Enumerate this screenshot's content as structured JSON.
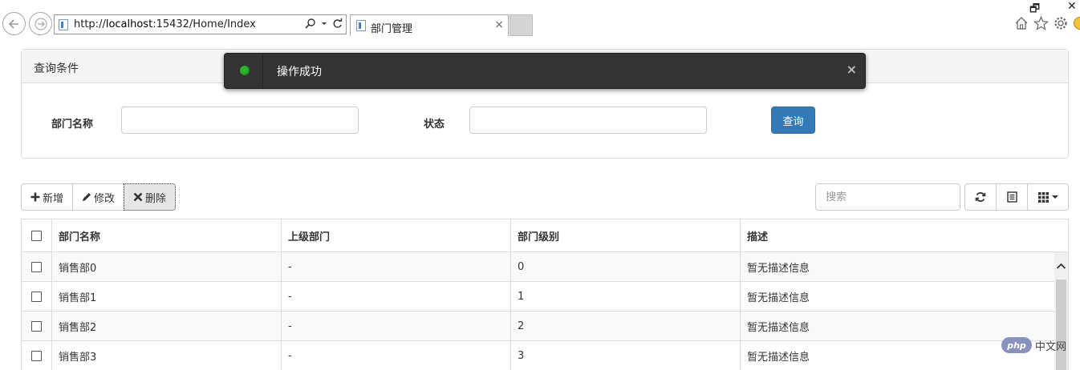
{
  "browser": {
    "url_host": "http://",
    "url_domain": "localhost",
    "url_path": ":15432/Home/Index",
    "tab_title": "部门管理",
    "tab_close": "×",
    "win_restore": "🗗",
    "win_close": "✕"
  },
  "query_panel": {
    "title": "查询条件",
    "dept_name_label": "部门名称",
    "dept_name_value": "",
    "status_label": "状态",
    "status_value": "",
    "query_button": "查询"
  },
  "toast": {
    "message": "操作成功",
    "close": "×",
    "status_color": "#2bb52b"
  },
  "toolbar": {
    "add_label": "新增",
    "edit_label": "修改",
    "delete_label": "删除",
    "search_placeholder": "搜索",
    "add_icon": "plus-icon",
    "edit_icon": "pencil-icon",
    "delete_icon": "x-icon",
    "refresh_icon": "refresh-icon",
    "list_icon": "list-icon",
    "columns_icon": "grid-icon"
  },
  "table": {
    "columns": [
      "部门名称",
      "上级部门",
      "部门级别",
      "描述"
    ],
    "rows": [
      [
        "销售部0",
        "-",
        "0",
        "暂无描述信息"
      ],
      [
        "销售部1",
        "-",
        "1",
        "暂无描述信息"
      ],
      [
        "销售部2",
        "-",
        "2",
        "暂无描述信息"
      ],
      [
        "销售部3",
        "-",
        "3",
        "暂无描述信息"
      ]
    ]
  },
  "watermark": {
    "logo": "php",
    "text": "中文网"
  },
  "colors": {
    "primary": "#337ab7",
    "toast_bg": "#333333",
    "border": "#dddddd"
  }
}
